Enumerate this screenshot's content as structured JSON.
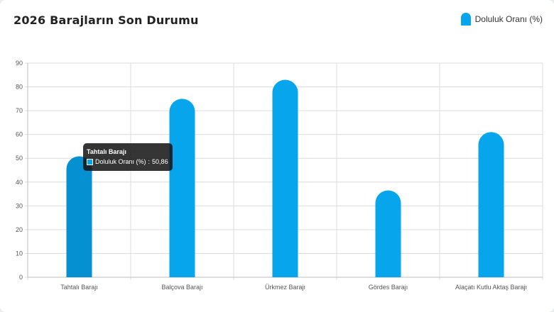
{
  "title": "2026 Barajların Son Durumu",
  "legend": {
    "label": "Doluluk Oranı (%)"
  },
  "colors": {
    "bar": "#06a5ec",
    "bar_active": "#0590d2",
    "grid": "#dcdcdc",
    "axis": "#bdbdbd"
  },
  "tooltip": {
    "title": "Tahtalı Barajı",
    "series_label": "Doluluk Oranı (%)",
    "value_text": "50,86"
  },
  "chart_data": {
    "type": "bar",
    "title": "2026 Barajların Son Durumu",
    "xlabel": "",
    "ylabel": "",
    "ylim": [
      0,
      90
    ],
    "yticks": [
      0,
      10,
      20,
      30,
      40,
      50,
      60,
      70,
      80,
      90
    ],
    "grid": true,
    "legend": "top-right",
    "categories": [
      "Tahtalı Barajı",
      "Balçova Barajı",
      "Ürkmez Barajı",
      "Gördes Barajı",
      "Alaçatı Kutlu Aktaş Barajı"
    ],
    "series": [
      {
        "name": "Doluluk Oranı (%)",
        "values": [
          50.86,
          75,
          83,
          36.5,
          61
        ]
      }
    ],
    "highlighted_index": 0
  }
}
